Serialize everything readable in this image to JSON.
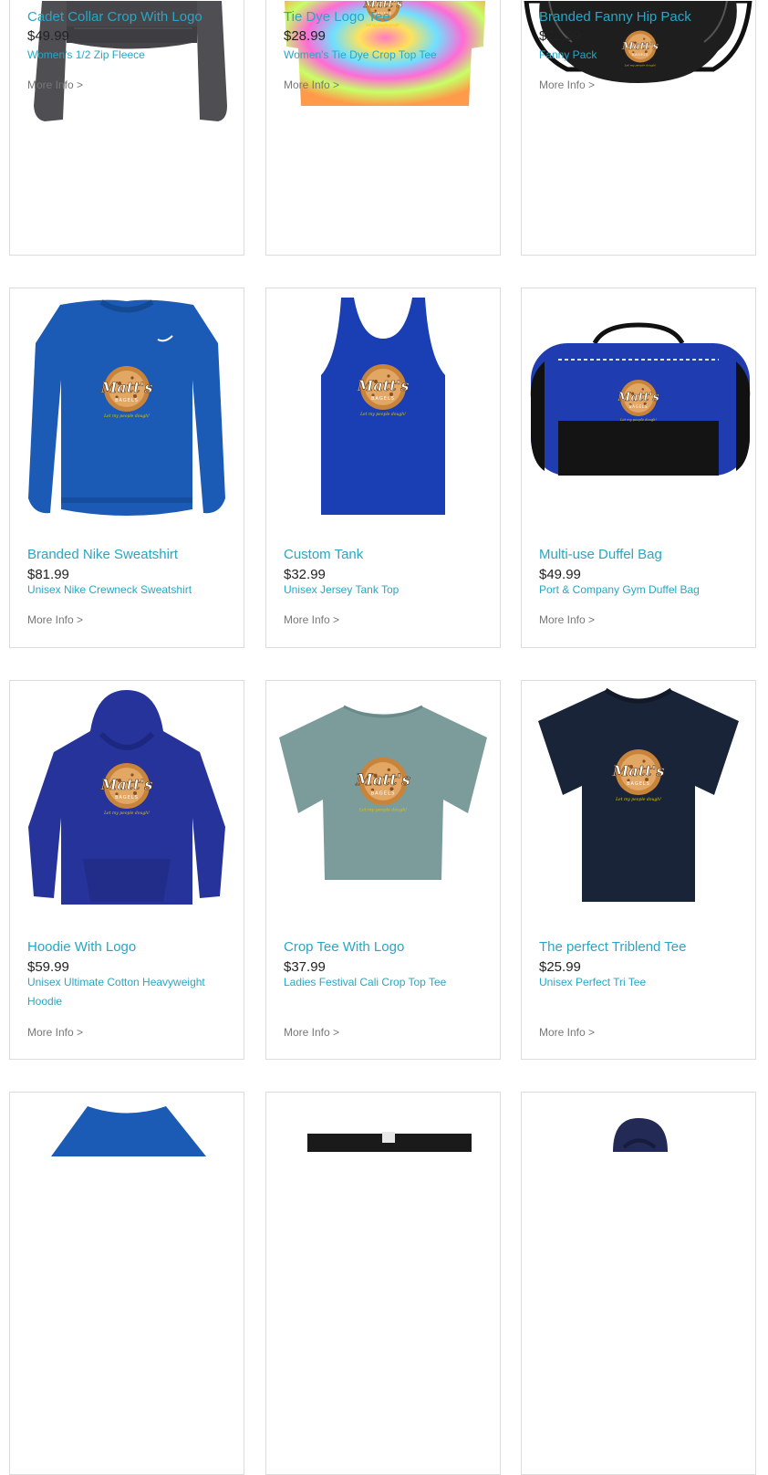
{
  "products": [
    {
      "title": "Cadet Collar Crop With Logo",
      "price": "$49.99",
      "description": "Women's 1/2 Zip Fleece",
      "more_info": "More Info >",
      "image": "charcoal-crop-fleece"
    },
    {
      "title": "Tie Dye Logo Tee",
      "price": "$28.99",
      "description": "Women's Tie Dye Crop Top Tee",
      "more_info": "More Info >",
      "image": "tie-dye-crop-tee"
    },
    {
      "title": "Branded Fanny Hip Pack",
      "price": "$22.99",
      "description": "Fanny Pack",
      "more_info": "More Info >",
      "image": "black-fanny-pack"
    },
    {
      "title": "Branded Nike Sweatshirt",
      "price": "$81.99",
      "description": "Unisex Nike Crewneck Sweatshirt",
      "more_info": "More Info >",
      "image": "blue-crewneck-sweatshirt"
    },
    {
      "title": "Custom Tank",
      "price": "$32.99",
      "description": "Unisex Jersey Tank Top",
      "more_info": "More Info >",
      "image": "blue-tank-top"
    },
    {
      "title": "Multi-use Duffel Bag",
      "price": "$49.99",
      "description": "Port & Company Gym Duffel Bag",
      "more_info": "More Info >",
      "image": "blue-duffel-bag"
    },
    {
      "title": "Hoodie With Logo",
      "price": "$59.99",
      "description": "Unisex Ultimate Cotton Heavyweight Hoodie",
      "more_info": "More Info >",
      "image": "blue-hoodie"
    },
    {
      "title": "Crop Tee With Logo",
      "price": "$37.99",
      "description": "Ladies Festival Cali Crop Top Tee",
      "more_info": "More Info >",
      "image": "sage-crop-tee"
    },
    {
      "title": "The perfect Triblend Tee",
      "price": "$25.99",
      "description": "Unisex Perfect Tri Tee",
      "more_info": "More Info >",
      "image": "navy-triblend-tee"
    },
    {
      "title": "",
      "price": "",
      "description": "",
      "more_info": "",
      "image": "blue-shirt-partial"
    },
    {
      "title": "",
      "price": "",
      "description": "",
      "more_info": "",
      "image": "black-item-partial"
    },
    {
      "title": "",
      "price": "",
      "description": "",
      "more_info": "",
      "image": "navy-hoodie-partial"
    }
  ],
  "logo": {
    "line1": "Matt's",
    "line2": "BAGELS",
    "tagline": "Let my people dough!"
  },
  "colors": {
    "link": "#29a6c4",
    "price": "#222222",
    "muted": "#777777",
    "border": "#dcdcdc"
  }
}
